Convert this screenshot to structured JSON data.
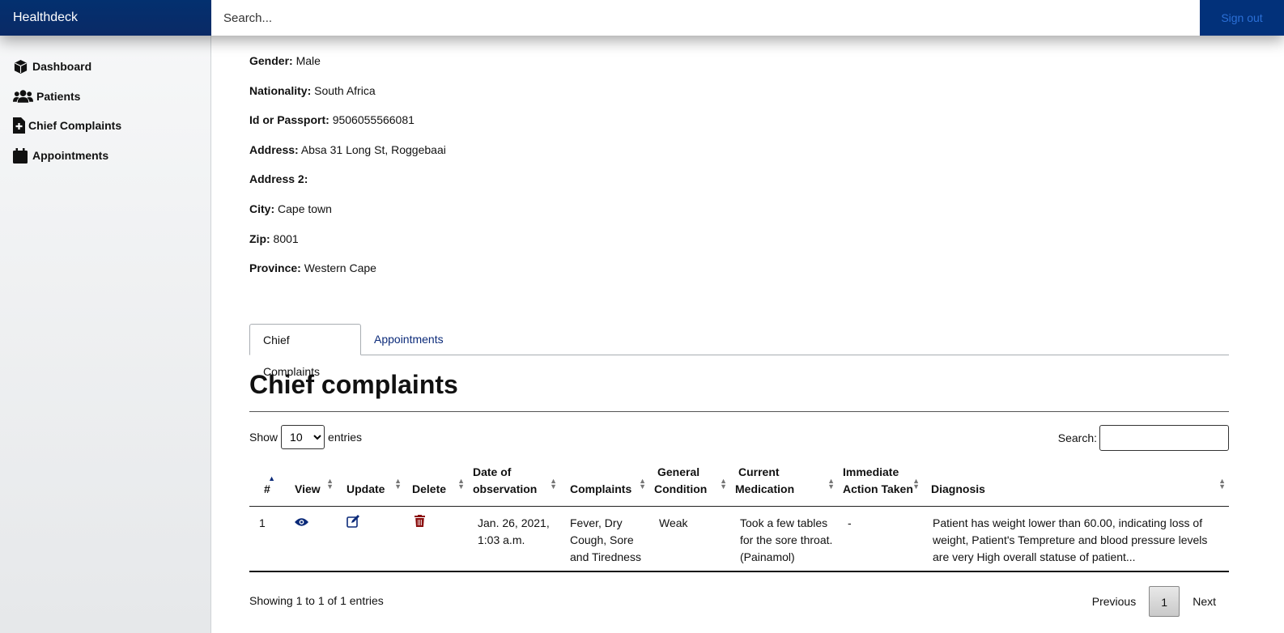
{
  "app": {
    "brand": "Healthdeck",
    "search_placeholder": "Search...",
    "signout": "Sign out"
  },
  "sidebar": {
    "items": [
      {
        "label": "Dashboard",
        "icon": "cube-icon"
      },
      {
        "label": "Patients",
        "icon": "users-icon"
      },
      {
        "label": "Chief Complaints",
        "icon": "file-medical-icon"
      },
      {
        "label": "Appointments",
        "icon": "calendar-icon"
      }
    ]
  },
  "patient": {
    "fields": [
      {
        "label": "Gender:",
        "value": "Male"
      },
      {
        "label": "Nationality:",
        "value": "South Africa"
      },
      {
        "label": "Id or Passport:",
        "value": "9506055566081"
      },
      {
        "label": "Address:",
        "value": "Absa 31 Long St, Roggebaai"
      },
      {
        "label": "Address 2:",
        "value": ""
      },
      {
        "label": "City:",
        "value": "Cape town"
      },
      {
        "label": "Zip:",
        "value": "8001"
      },
      {
        "label": "Province:",
        "value": "Western Cape"
      }
    ]
  },
  "tabs": [
    {
      "label": "Chief Complaints"
    },
    {
      "label": "Appointments"
    }
  ],
  "section": {
    "title": "Chief complaints"
  },
  "table_controls": {
    "show_label": "Show",
    "entries_label": "entries",
    "page_size": "10",
    "search_label": "Search:"
  },
  "table": {
    "headers": [
      "#",
      "View",
      "Update",
      "Delete",
      "Date of observation",
      "Complaints",
      "General Condition",
      "Current Medication",
      "Immediate Action Taken",
      "Diagnosis"
    ],
    "rows": [
      {
        "num": "1",
        "date": "Jan. 26, 2021, 1:03 a.m.",
        "complaints": "Fever, Dry Cough, Sore and Tiredness",
        "condition": "Weak",
        "medication": "Took a few tables for the sore throat. (Painamol)",
        "action": "-",
        "diagnosis": "Patient has weight lower than 60.00, indicating loss of weight, Patient's Tempreture and blood pressure levels are very High overall statuse of patient..."
      }
    ]
  },
  "footer": {
    "info": "Showing 1 to 1 of 1 entries",
    "previous": "Previous",
    "page": "1",
    "next": "Next"
  },
  "colors": {
    "navbar": "#02317a",
    "link": "#0b2a79",
    "delete": "#8b0f0f"
  }
}
